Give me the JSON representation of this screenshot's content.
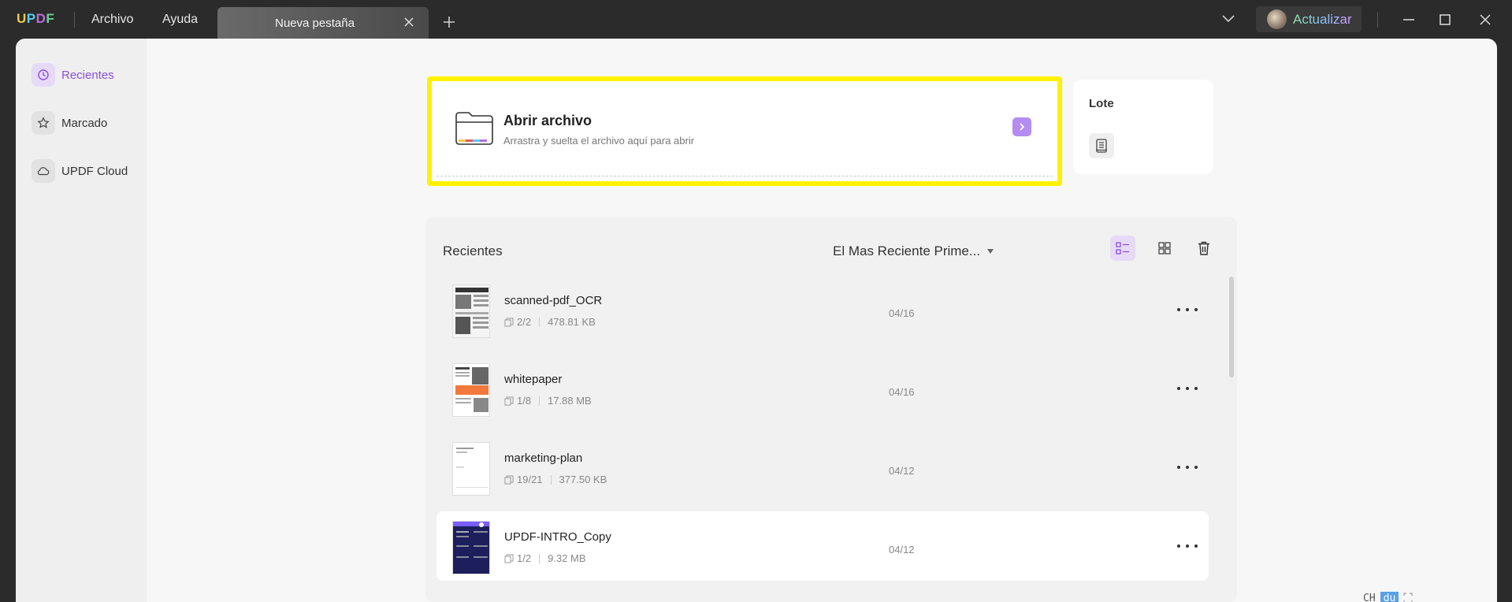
{
  "app": {
    "logo": {
      "u": "U",
      "p": "P",
      "d": "D",
      "f": "F"
    },
    "menu": [
      "Archivo",
      "Ayuda"
    ],
    "tab_title": "Nueva pestaña",
    "upgrade_label": "Actualizar"
  },
  "sidebar": {
    "items": [
      {
        "label": "Recientes",
        "icon": "clock-icon",
        "active": true
      },
      {
        "label": "Marcado",
        "icon": "star-icon",
        "active": false
      },
      {
        "label": "UPDF Cloud",
        "icon": "cloud-icon",
        "active": false
      }
    ]
  },
  "open_file": {
    "title": "Abrir archivo",
    "subtitle": "Arrastra y suelta el archivo aquí para abrir"
  },
  "batch": {
    "title": "Lote"
  },
  "recent": {
    "title": "Recientes",
    "sort_label": "El Mas Reciente Prime...",
    "files": [
      {
        "name": "scanned-pdf_OCR",
        "pages": "2/2",
        "size": "478.81 KB",
        "date": "04/16"
      },
      {
        "name": "whitepaper",
        "pages": "1/8",
        "size": "17.88 MB",
        "date": "04/16"
      },
      {
        "name": "marketing-plan",
        "pages": "19/21",
        "size": "377.50 KB",
        "date": "04/12"
      },
      {
        "name": "UPDF-INTRO_Copy",
        "pages": "1/2",
        "size": "9.32 MB",
        "date": "04/12"
      }
    ]
  },
  "ime": {
    "ch": "CH",
    "du": "du"
  },
  "colors": {
    "accent": "#8b4fd8",
    "highlight": "#fff200",
    "titlebar": "#2b2b2b"
  }
}
